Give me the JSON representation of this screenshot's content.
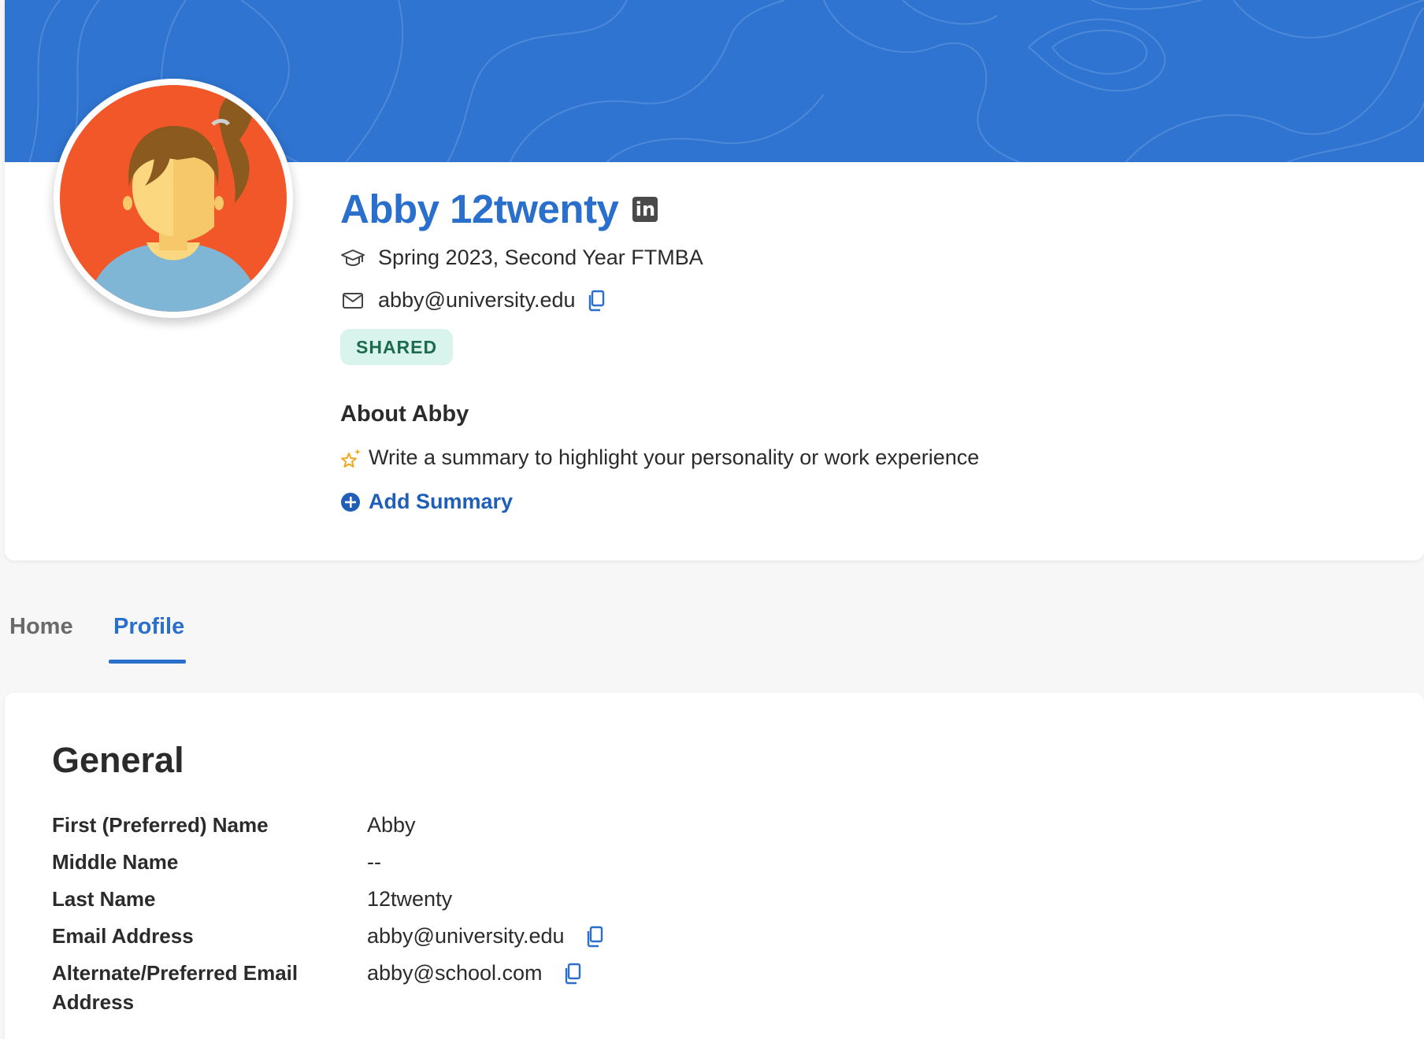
{
  "profile": {
    "name": "Abby 12twenty",
    "linkedin_label": "in",
    "program": "Spring 2023, Second Year FTMBA",
    "email": "abby@university.edu",
    "badge": "SHARED",
    "about_title": "About Abby",
    "about_hint": "Write a summary to highlight your personality or work experience",
    "add_summary": "Add Summary"
  },
  "tabs": [
    {
      "label": "Home",
      "active": false
    },
    {
      "label": "Profile",
      "active": true
    }
  ],
  "general": {
    "title": "General",
    "fields": [
      {
        "label": "First (Preferred) Name",
        "value": "Abby"
      },
      {
        "label": "Middle Name",
        "value": "--"
      },
      {
        "label": "Last Name",
        "value": "12twenty"
      },
      {
        "label": "Email Address",
        "value": "abby@university.edu"
      },
      {
        "label": "Alternate/Preferred Email Address",
        "value": "abby@school.com"
      }
    ]
  },
  "colors": {
    "banner": "#2f74d0",
    "accent": "#2a6fcc",
    "badge_bg": "#d9f4ec",
    "badge_text": "#1d6b4e",
    "avatar_bg": "#f2572a"
  },
  "icons": {
    "linkedin": "linkedin-icon",
    "program": "graduation-cap-icon",
    "email": "envelope-icon",
    "copy": "copy-icon",
    "hint": "sparkle-star-icon",
    "add": "plus-circle-icon"
  }
}
